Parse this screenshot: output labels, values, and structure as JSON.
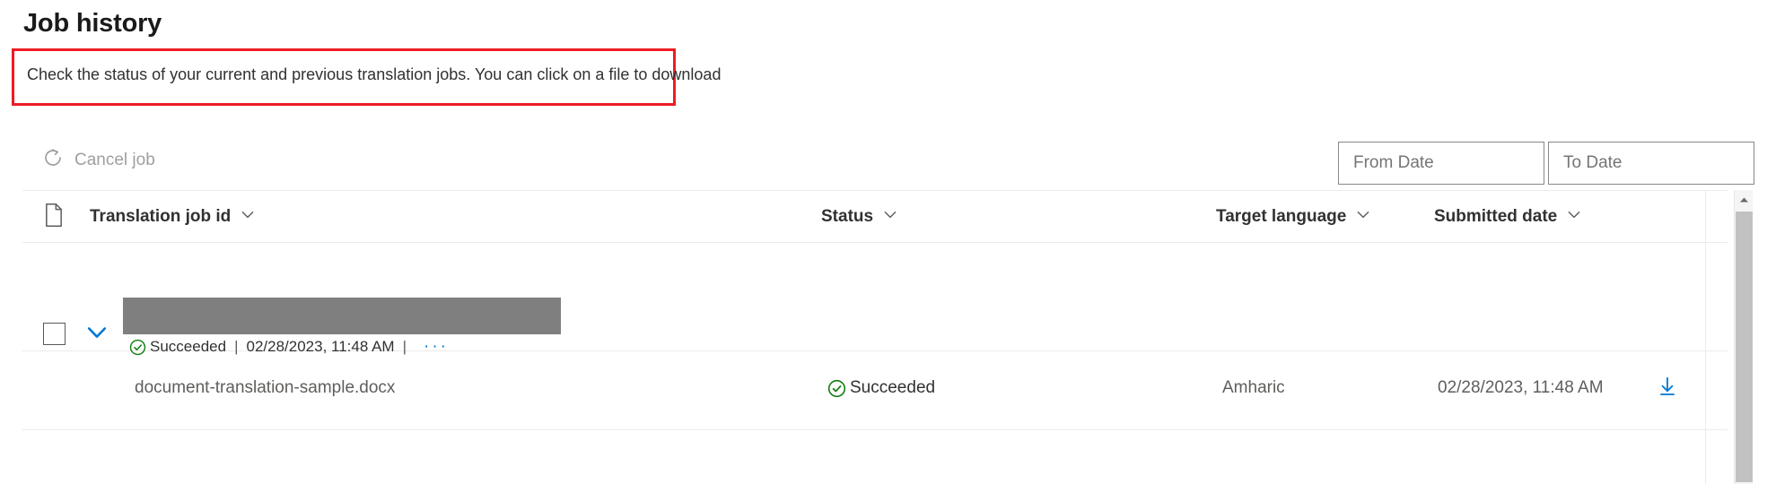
{
  "header": {
    "title": "Job history",
    "description": "Check the status of your current and previous translation jobs. You can click on a file to download",
    "highlight_color": "#ed1c24"
  },
  "toolbar": {
    "cancel_job_label": "Cancel job",
    "cancel_job_icon": "cancel-circle-arrow-icon",
    "cancel_job_disabled_color": "#a19f9d",
    "from_date_placeholder": "From Date",
    "to_date_placeholder": "To Date",
    "from_date_value": "",
    "to_date_value": "",
    "calendar_icon": "calendar-icon"
  },
  "table": {
    "columns": [
      {
        "key": "doc",
        "label": "",
        "icon": "document-icon",
        "sortable": false
      },
      {
        "key": "job_id",
        "label": "Translation job id",
        "icon": "chevron-down-icon",
        "sortable": true
      },
      {
        "key": "status",
        "label": "Status",
        "icon": "chevron-down-icon",
        "sortable": true
      },
      {
        "key": "target_language",
        "label": "Target language",
        "icon": "chevron-down-icon",
        "sortable": true
      },
      {
        "key": "submitted_date",
        "label": "Submitted date",
        "icon": "chevron-down-icon",
        "sortable": true
      }
    ],
    "group_row": {
      "checkbox_checked": false,
      "expanded": true,
      "expander_icon": "chevron-down-icon",
      "expander_color": "#0078d4",
      "job_id_redacted": true,
      "job_id_redaction_color": "#7f7f7f",
      "status": "Succeeded",
      "status_icon": "check-circle-icon",
      "status_color": "#107c10",
      "submitted_date": "02/28/2023, 11:48 AM",
      "separator": "|",
      "overflow_icon": "ellipsis-icon"
    },
    "file_rows": [
      {
        "file_name": "document-translation-sample.docx",
        "status": "Succeeded",
        "status_icon": "check-circle-icon",
        "status_color": "#107c10",
        "target_language": "Amharic",
        "submitted_date": "02/28/2023, 11:48 AM",
        "download_icon": "download-icon",
        "download_color": "#0078d4"
      }
    ]
  },
  "scrollbar": {
    "up_arrow_icon": "caret-up-icon",
    "thumb_color": "#c1c1c1",
    "track_color": "#f5f5f5"
  }
}
